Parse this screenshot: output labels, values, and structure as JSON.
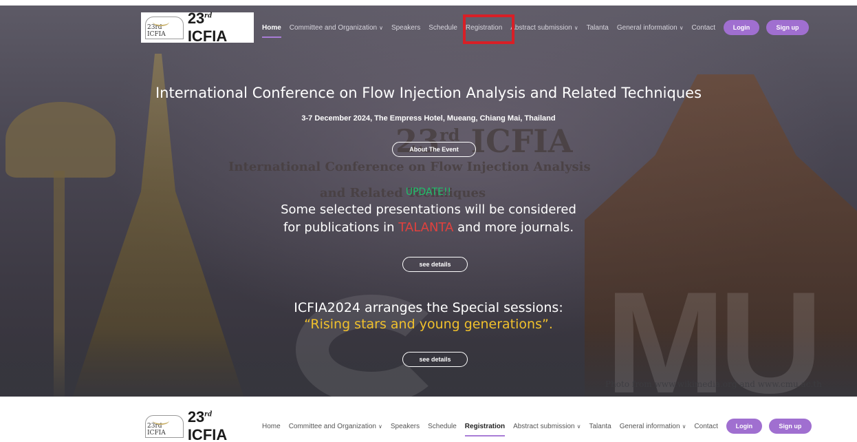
{
  "nav": {
    "logo_small": "23rd ICFIA",
    "logo_big": "23",
    "logo_sup": "rd",
    "logo_suffix": " ICFIA",
    "items": [
      {
        "label": "Home",
        "dropdown": false
      },
      {
        "label": "Committee and Organization",
        "dropdown": true
      },
      {
        "label": "Speakers",
        "dropdown": false
      },
      {
        "label": "Schedule",
        "dropdown": false
      },
      {
        "label": "Registration",
        "dropdown": false
      },
      {
        "label": "Abstract submission",
        "dropdown": true
      },
      {
        "label": "Talanta",
        "dropdown": false
      },
      {
        "label": "General information",
        "dropdown": true
      },
      {
        "label": "Contact",
        "dropdown": false
      }
    ],
    "login": "Login",
    "signup": "Sign up",
    "chevron": "∨"
  },
  "hero": {
    "title": "International Conference on Flow Injection Analysis and Related Techniques",
    "subtitle": "3-7 December 2024, The Empress Hotel, Mueang, Chiang Mai, Thailand",
    "about_button": "About The Event",
    "update_label": "UPDATE!!",
    "announce_line1": "Some selected presentations will be considered",
    "announce_line2_pre": "for publications in ",
    "announce_line2_red": "TALANTA",
    "announce_line2_post": " and more journals.",
    "details_button_1": "see details",
    "special_line1": "ICFIA2024 arranges the Special sessions:",
    "special_line2": "“Rising stars and young generations”.",
    "details_button_2": "see details",
    "watermark_23": "23",
    "watermark_rd": "rd",
    "watermark_icfia": " ICFIA",
    "watermark_line1": "International Conference on Flow Injection Analysis",
    "watermark_line2": "and Related Techniques",
    "photo_credit": "Photo from www.wikimedia.org and www.cmu.ac.th",
    "cmu_letters": "MU"
  },
  "colors": {
    "accent": "#a06fd0",
    "highlight_border": "#d81f26",
    "update_green": "#1fc06a",
    "talanta_red": "#e0413e",
    "special_yellow": "#f0c02c"
  }
}
